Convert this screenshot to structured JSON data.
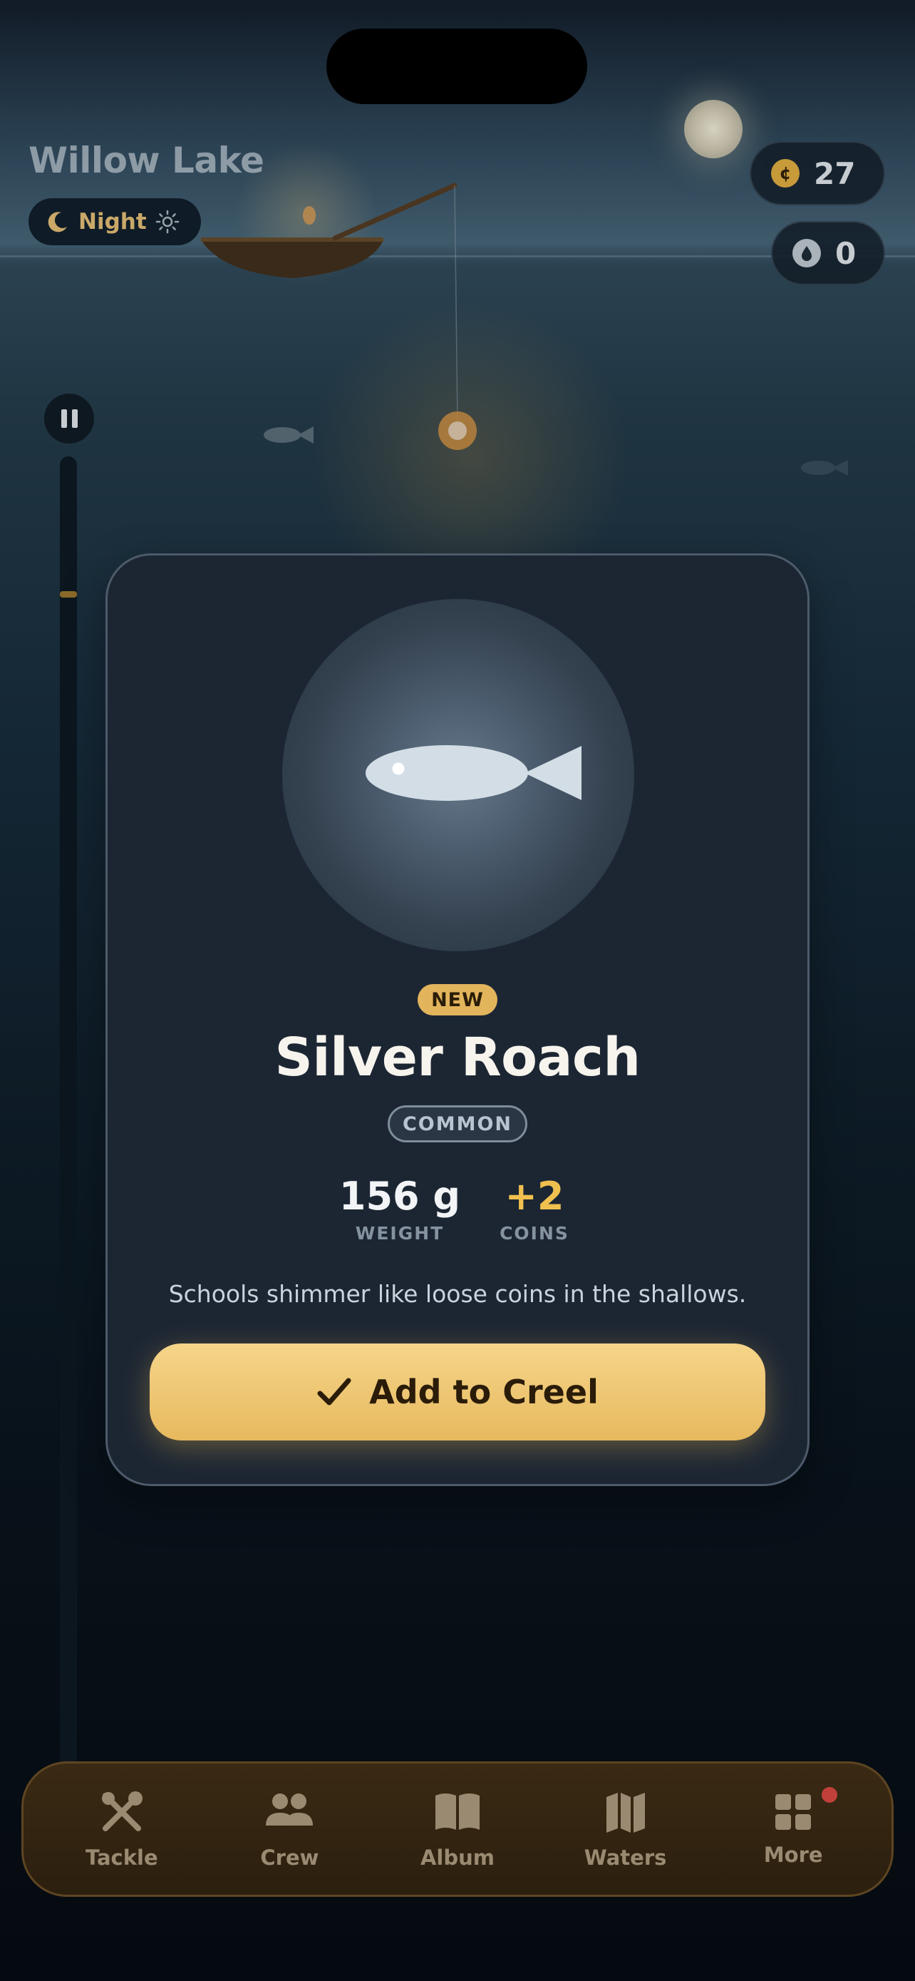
{
  "location": {
    "title": "Willow Lake",
    "time_of_day": "Night",
    "time_icon": "moon-icon",
    "toggle_icon": "sun-icon"
  },
  "currency": {
    "coins": {
      "icon": "coin-icon",
      "value": "27"
    },
    "drops": {
      "icon": "drop-icon",
      "value": "0"
    }
  },
  "catch_card": {
    "badge": "NEW",
    "fish_name": "Silver Roach",
    "rarity": "COMMON",
    "stats": [
      {
        "value": "156 g",
        "label": "WEIGHT"
      },
      {
        "value": "+2",
        "label": "COINS"
      }
    ],
    "description": "Schools shimmer like loose coins in the shallows.",
    "action": {
      "icon": "checkmark-icon",
      "label": "Add to Creel"
    }
  },
  "tab_bar": {
    "items": [
      {
        "label": "Tackle",
        "icon": "tackle-icon"
      },
      {
        "label": "Crew",
        "icon": "crew-icon"
      },
      {
        "label": "Album",
        "icon": "album-icon"
      },
      {
        "label": "Waters",
        "icon": "waters-icon"
      },
      {
        "label": "More",
        "icon": "grid-icon",
        "has_notification": true
      }
    ]
  },
  "colors": {
    "accent": "#e7b95e",
    "card": "#1c2633",
    "notification": "#c2403a"
  }
}
